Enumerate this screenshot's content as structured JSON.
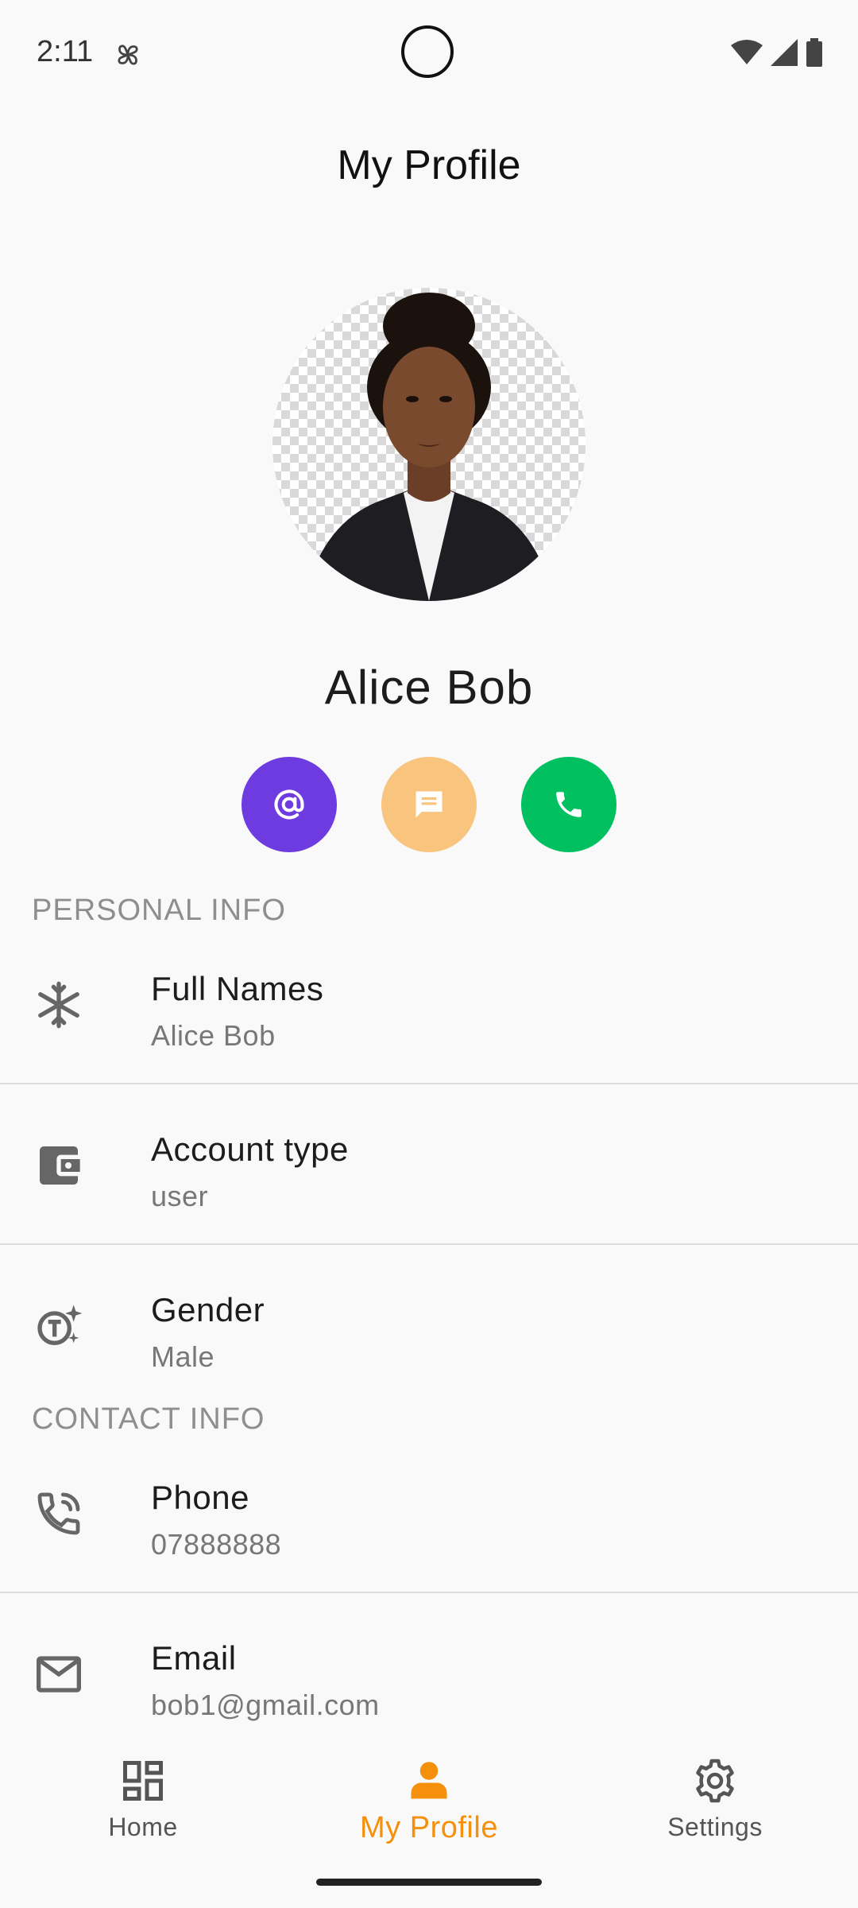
{
  "status_bar": {
    "time": "2:11"
  },
  "header": {
    "title": "My Profile"
  },
  "profile": {
    "name": "Alice Bob"
  },
  "action_buttons": [
    {
      "icon": "at-sign-icon",
      "color": "#6e3be0"
    },
    {
      "icon": "message-icon",
      "color": "#f9c47e"
    },
    {
      "icon": "phone-icon",
      "color": "#00c060"
    }
  ],
  "personal_info": {
    "label": "PERSONAL INFO",
    "rows": [
      {
        "icon": "snowflake-icon",
        "title": "Full Names",
        "value": "Alice Bob"
      },
      {
        "icon": "wallet-icon",
        "title": "Account type",
        "value": "user"
      },
      {
        "icon": "gender-icon",
        "title": "Gender",
        "value": "Male"
      }
    ]
  },
  "contact_info": {
    "label": "CONTACT INFO",
    "rows": [
      {
        "icon": "phone-call-icon",
        "title": "Phone",
        "value": "07888888"
      },
      {
        "icon": "mail-icon",
        "title": "Email",
        "value": "bob1@gmail.com"
      }
    ]
  },
  "bottom_nav": {
    "accent": "#f5900c",
    "items": [
      {
        "label": "Home",
        "icon": "dashboard-icon"
      },
      {
        "label": "My Profile",
        "icon": "person-icon",
        "active": true
      },
      {
        "label": "Settings",
        "icon": "gear-icon"
      }
    ]
  }
}
